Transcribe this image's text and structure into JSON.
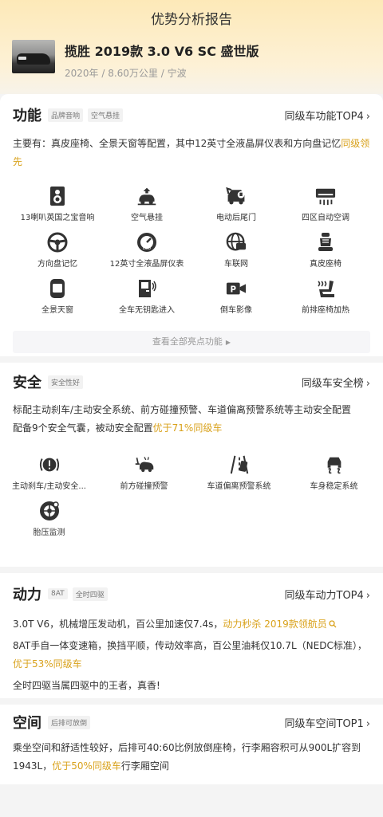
{
  "header": {
    "title": "优势分析报告"
  },
  "car": {
    "name": "揽胜 2019款 3.0 V6 SC 盛世版",
    "meta": "2020年 / 8.60万公里 / 宁波"
  },
  "function": {
    "title": "功能",
    "tags": [
      "品牌音响",
      "空气悬挂"
    ],
    "link": "同级车功能TOP4",
    "desc_pre": "主要有：真皮座椅、全景天窗等配置，其中12英寸全液晶屏仪表和方向盘记忆",
    "desc_hl": "同级领先",
    "features": [
      {
        "label": "13喇叭英国之宝音响",
        "icon": "speaker-icon"
      },
      {
        "label": "空气悬挂",
        "icon": "air-suspension-icon"
      },
      {
        "label": "电动后尾门",
        "icon": "power-tailgate-icon"
      },
      {
        "label": "四区自动空调",
        "icon": "air-conditioner-icon"
      },
      {
        "label": "方向盘记忆",
        "icon": "steering-wheel-icon"
      },
      {
        "label": "12英寸全液晶屏仪表",
        "icon": "lcd-dashboard-icon"
      },
      {
        "label": "车联网",
        "icon": "connected-car-icon"
      },
      {
        "label": "真皮座椅",
        "icon": "leather-seat-icon"
      },
      {
        "label": "全景天窗",
        "icon": "panoramic-sunroof-icon"
      },
      {
        "label": "全车无钥匙进入",
        "icon": "keyless-entry-icon"
      },
      {
        "label": "倒车影像",
        "icon": "reverse-camera-icon"
      },
      {
        "label": "前排座椅加热",
        "icon": "seat-heating-icon"
      }
    ],
    "more": "查看全部亮点功能",
    "more_arrow": "▶"
  },
  "safety": {
    "title": "安全",
    "tags": [
      "安全性好"
    ],
    "link": "同级车安全榜",
    "desc1": "标配主动刹车/主动安全系统、前方碰撞预警、车道偏离预警系统等主动安全配置",
    "desc2_pre": "配备9个安全气囊，被动安全配置",
    "desc2_hl": "优于71%同级车",
    "features": [
      {
        "label": "主动刹车/主动安全...",
        "icon": "active-brake-icon"
      },
      {
        "label": "前方碰撞预警",
        "icon": "collision-warning-icon"
      },
      {
        "label": "车道偏离预警系统",
        "icon": "lane-departure-icon"
      },
      {
        "label": "车身稳定系统",
        "icon": "stability-control-icon"
      },
      {
        "label": "胎压监测",
        "icon": "tire-pressure-icon"
      }
    ]
  },
  "power": {
    "title": "动力",
    "tags": [
      "8AT",
      "全时四驱"
    ],
    "link": "同级车动力TOP4",
    "p1_pre": "3.0T V6，机械增压发动机，百公里加速仅7.4s，",
    "p1_hl": "动力秒杀 2019款领航员",
    "p2_pre": "8AT手自一体变速箱，换挡平顺，传动效率高，百公里油耗仅10.7L（NEDC标准），",
    "p2_hl": "优于53%同级车",
    "p3": "全时四驱当属四驱中的王者，真香!"
  },
  "space": {
    "title": "空间",
    "tags": [
      "后排可放倒"
    ],
    "link": "同级车空间TOP1",
    "desc_pre": "乘坐空间和舒适性较好，后排可40:60比例放倒座椅，行李厢容积可从900L扩容到1943L，",
    "desc_hl": "优于50%同级车",
    "desc_post": "行李厢空间"
  },
  "chevron": "›",
  "colors": {
    "accent": "#d9a21c",
    "bg": "#f4f4f4"
  }
}
